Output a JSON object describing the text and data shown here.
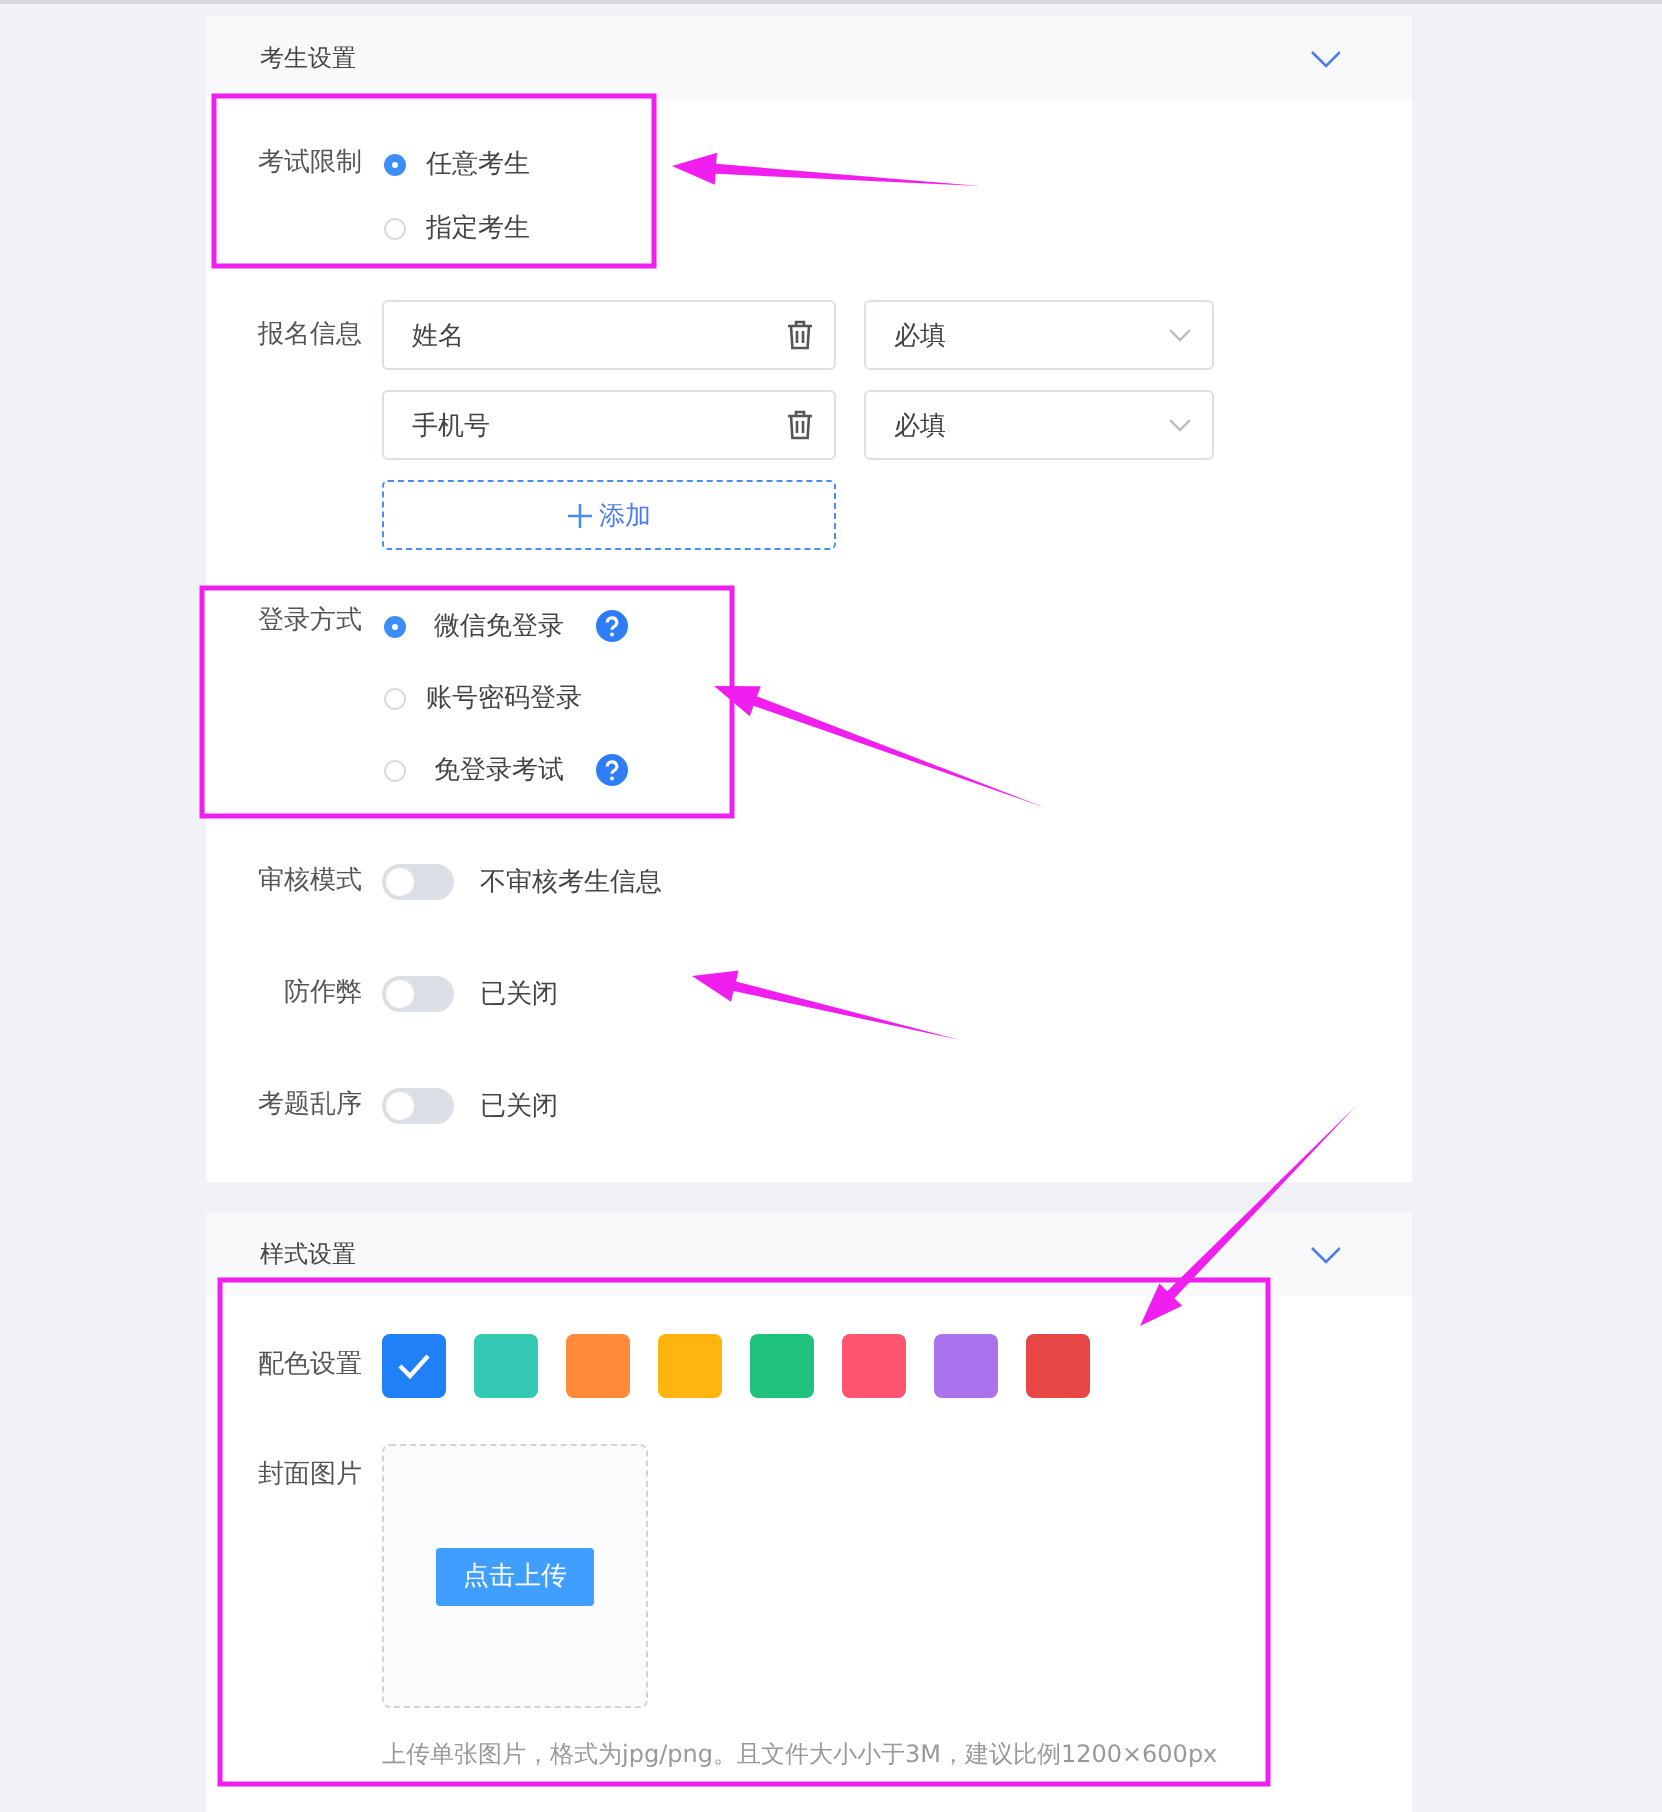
{
  "sections": [
    {
      "title": "考生设置",
      "fields": [
        {
          "kind": "radio",
          "label": "考试限制",
          "options": [
            {
              "label": "任意考生",
              "selected": true,
              "help": false
            },
            {
              "label": "指定考生",
              "selected": false,
              "help": false
            }
          ]
        },
        {
          "kind": "fields",
          "label": "报名信息",
          "items": [
            {
              "value": "姓名",
              "requirement": "必填"
            },
            {
              "value": "手机号",
              "requirement": "必填"
            }
          ],
          "add_button": "添加"
        },
        {
          "kind": "radio",
          "label": "登录方式",
          "options": [
            {
              "label": "微信免登录",
              "selected": true,
              "help": true
            },
            {
              "label": "账号密码登录",
              "selected": false,
              "help": false
            },
            {
              "label": "免登录考试",
              "selected": false,
              "help": true
            }
          ]
        },
        {
          "kind": "switch",
          "label": "审核模式",
          "on": false,
          "status": "不审核考生信息"
        },
        {
          "kind": "switch",
          "label": "防作弊",
          "on": false,
          "status": "已关闭"
        },
        {
          "kind": "switch",
          "label": "考题乱序",
          "on": false,
          "status": "已关闭"
        }
      ]
    },
    {
      "title": "样式设置",
      "fields": [
        {
          "kind": "colors",
          "label": "配色设置",
          "swatches": [
            {
              "color": "#2080f7",
              "selected": true
            },
            {
              "color": "#33c9b3",
              "selected": false
            },
            {
              "color": "#ff8a3a",
              "selected": false
            },
            {
              "color": "#ffb410",
              "selected": false
            },
            {
              "color": "#1fc27a",
              "selected": false
            },
            {
              "color": "#ff5470",
              "selected": false
            },
            {
              "color": "#ab72ee",
              "selected": false
            },
            {
              "color": "#e84545",
              "selected": false
            }
          ]
        },
        {
          "kind": "upload",
          "label": "封面图片",
          "button": "点击上传",
          "hint": "上传单张图片，格式为jpg/png。且文件大小小于3M，建议比例1200×600px"
        }
      ]
    }
  ]
}
